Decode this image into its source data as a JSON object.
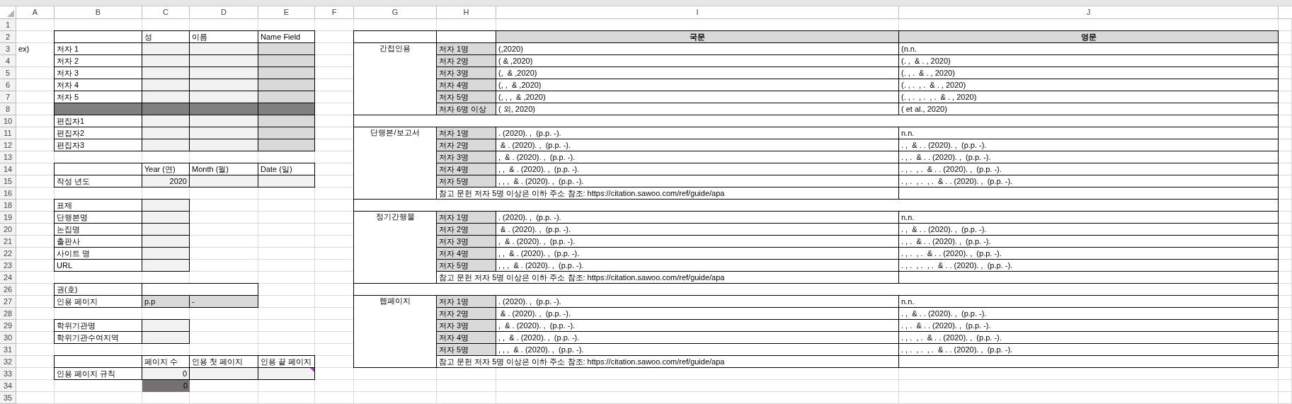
{
  "column_headers": [
    "A",
    "B",
    "C",
    "D",
    "E",
    "F",
    "G",
    "H",
    "I",
    "J"
  ],
  "rows": [
    {
      "number": "1"
    },
    {
      "number": "2",
      "cells": [
        {
          "kind": "blank"
        },
        {
          "kind": "label"
        },
        {
          "kind": "label",
          "text": "성"
        },
        {
          "kind": "label",
          "text": "이름"
        },
        {
          "kind": "label",
          "text": "Name Field"
        },
        {
          "kind": "blank"
        },
        {
          "kind": "label"
        },
        {
          "kind": "label"
        },
        {
          "kind": "head",
          "text": "국문"
        },
        {
          "kind": "head",
          "text": "영문"
        }
      ]
    },
    {
      "number": "3",
      "cells": [
        {
          "kind": "plain",
          "text": "ex)"
        },
        {
          "kind": "label",
          "text": "저자 1"
        },
        {
          "kind": "input"
        },
        {
          "kind": "input"
        },
        {
          "kind": "field"
        },
        {
          "kind": "blank"
        },
        {
          "kind": "group",
          "text": "간접인용"
        },
        {
          "kind": "key",
          "text": "저자 1명"
        },
        {
          "kind": "label",
          "text": "(,2020)"
        },
        {
          "kind": "label",
          "text": "(n.n."
        }
      ]
    },
    {
      "number": "4",
      "cells": [
        {
          "kind": "blank"
        },
        {
          "kind": "label",
          "text": "저자 2"
        },
        {
          "kind": "input"
        },
        {
          "kind": "input"
        },
        {
          "kind": "field"
        },
        {
          "kind": "blank"
        },
        {
          "kind": "up"
        },
        {
          "kind": "key",
          "text": "저자 2명"
        },
        {
          "kind": "label",
          "text": "( & ,2020)"
        },
        {
          "kind": "label",
          "text": "(. ,  & . , 2020)"
        }
      ]
    },
    {
      "number": "5",
      "cells": [
        {
          "kind": "blank"
        },
        {
          "kind": "label",
          "text": "저자 3"
        },
        {
          "kind": "input"
        },
        {
          "kind": "input"
        },
        {
          "kind": "field"
        },
        {
          "kind": "blank"
        },
        {
          "kind": "up"
        },
        {
          "kind": "key",
          "text": "저자 3명"
        },
        {
          "kind": "label",
          "text": "(,  & ,2020)"
        },
        {
          "kind": "label",
          "text": "(. , .  & . , 2020)"
        }
      ]
    },
    {
      "number": "6",
      "cells": [
        {
          "kind": "blank"
        },
        {
          "kind": "label",
          "text": "저자 4"
        },
        {
          "kind": "input"
        },
        {
          "kind": "input"
        },
        {
          "kind": "field"
        },
        {
          "kind": "blank"
        },
        {
          "kind": "up"
        },
        {
          "kind": "key",
          "text": "저자 4명"
        },
        {
          "kind": "label",
          "text": "(, ,  & ,2020)"
        },
        {
          "kind": "label",
          "text": "(. , .  , .  & . , 2020)"
        }
      ]
    },
    {
      "number": "7",
      "cells": [
        {
          "kind": "blank"
        },
        {
          "kind": "label",
          "text": "저자 5"
        },
        {
          "kind": "input"
        },
        {
          "kind": "input"
        },
        {
          "kind": "field"
        },
        {
          "kind": "blank"
        },
        {
          "kind": "up"
        },
        {
          "kind": "key",
          "text": "저자 5명"
        },
        {
          "kind": "label",
          "text": "(, , ,  & ,2020)"
        },
        {
          "kind": "label",
          "text": "(. , .  , .  , .  & . , 2020)"
        }
      ]
    },
    {
      "number": "8",
      "cells": [
        {
          "kind": "blank"
        },
        {
          "kind": "dark"
        },
        {
          "kind": "dark"
        },
        {
          "kind": "dark"
        },
        {
          "kind": "dark"
        },
        {
          "kind": "blank"
        },
        {
          "kind": "up"
        },
        {
          "kind": "key",
          "text": "저자 6명 이상"
        },
        {
          "kind": "label",
          "text": "( 외, 2020)"
        },
        {
          "kind": "label",
          "text": "( et al., 2020)"
        }
      ]
    },
    {
      "number": "10",
      "cells": [
        {
          "kind": "blank"
        },
        {
          "kind": "label",
          "text": "편집자1"
        },
        {
          "kind": "input"
        },
        {
          "kind": "input"
        },
        {
          "kind": "field"
        },
        {
          "kind": "blank"
        },
        {
          "kind": "label"
        },
        {
          "kind": "left"
        },
        {
          "kind": "left"
        },
        {
          "kind": "left"
        }
      ]
    },
    {
      "number": "11",
      "cells": [
        {
          "kind": "blank"
        },
        {
          "kind": "label",
          "text": "편집자2"
        },
        {
          "kind": "input"
        },
        {
          "kind": "input"
        },
        {
          "kind": "field"
        },
        {
          "kind": "blank"
        },
        {
          "kind": "group",
          "text": "단행본/보고서"
        },
        {
          "kind": "key",
          "text": "저자 1명"
        },
        {
          "kind": "label",
          "text": ". (2020). ,  (p.p. -)."
        },
        {
          "kind": "label",
          "text": "n.n."
        }
      ]
    },
    {
      "number": "12",
      "cells": [
        {
          "kind": "blank"
        },
        {
          "kind": "label",
          "text": "편집자3"
        },
        {
          "kind": "input"
        },
        {
          "kind": "input"
        },
        {
          "kind": "field"
        },
        {
          "kind": "blank"
        },
        {
          "kind": "up"
        },
        {
          "kind": "key",
          "text": "저자 2명"
        },
        {
          "kind": "label",
          "text": " & . (2020). ,  (p.p. -)."
        },
        {
          "kind": "label",
          "text": ". ,  & . . (2020). ,  (p.p. -)."
        }
      ]
    },
    {
      "number": "13",
      "cells": [
        {
          "kind": "blank"
        },
        {
          "kind": "blank"
        },
        {
          "kind": "blank"
        },
        {
          "kind": "blank"
        },
        {
          "kind": "blank"
        },
        {
          "kind": "blank"
        },
        {
          "kind": "up"
        },
        {
          "kind": "key",
          "text": "저자 3명"
        },
        {
          "kind": "label",
          "text": ",  & . (2020). ,  (p.p. -)."
        },
        {
          "kind": "label",
          "text": ". , .  & . . (2020). ,  (p.p. -)."
        }
      ]
    },
    {
      "number": "14",
      "cells": [
        {
          "kind": "blank"
        },
        {
          "kind": "label"
        },
        {
          "kind": "label",
          "text": "Year (연)"
        },
        {
          "kind": "label",
          "text": "Month (월)"
        },
        {
          "kind": "label",
          "text": "Date (일)"
        },
        {
          "kind": "blank"
        },
        {
          "kind": "up"
        },
        {
          "kind": "key",
          "text": "저자 4명"
        },
        {
          "kind": "label",
          "text": ", ,  & . (2020). ,  (p.p. -)."
        },
        {
          "kind": "label",
          "text": ". , .  , .  & . . (2020). ,  (p.p. -)."
        }
      ]
    },
    {
      "number": "15",
      "cells": [
        {
          "kind": "blank"
        },
        {
          "kind": "label",
          "text": "작성 년도"
        },
        {
          "kind": "input-number",
          "text": "2020"
        },
        {
          "kind": "input"
        },
        {
          "kind": "input"
        },
        {
          "kind": "blank"
        },
        {
          "kind": "up"
        },
        {
          "kind": "key",
          "text": "저자 5명"
        },
        {
          "kind": "label",
          "text": ", , ,  & . (2020). ,  (p.p. -)."
        },
        {
          "kind": "label",
          "text": ". , .  , .  , .  & . . (2020). ,  (p.p. -)."
        }
      ]
    },
    {
      "number": "16",
      "cells": [
        {
          "kind": "blank"
        },
        {
          "kind": "blank"
        },
        {
          "kind": "blank"
        },
        {
          "kind": "blank"
        },
        {
          "kind": "blank"
        },
        {
          "kind": "blank"
        },
        {
          "kind": "up"
        },
        {
          "kind": "label",
          "text": "참고 문헌 저자 5명 이상은 이하 주소 참조: https://citation.sawoo.com/ref/guide/apa"
        },
        {
          "kind": "left"
        },
        {
          "kind": "label"
        }
      ]
    },
    {
      "number": "18",
      "cells": [
        {
          "kind": "blank"
        },
        {
          "kind": "label",
          "text": "표제"
        },
        {
          "kind": "input"
        },
        {
          "kind": "blank"
        },
        {
          "kind": "blank"
        },
        {
          "kind": "blank"
        },
        {
          "kind": "label"
        },
        {
          "kind": "left"
        },
        {
          "kind": "left"
        },
        {
          "kind": "left"
        }
      ]
    },
    {
      "number": "19",
      "cells": [
        {
          "kind": "blank"
        },
        {
          "kind": "label",
          "text": "단행본명"
        },
        {
          "kind": "input"
        },
        {
          "kind": "blank"
        },
        {
          "kind": "blank"
        },
        {
          "kind": "blank"
        },
        {
          "kind": "group",
          "text": "정기간행물"
        },
        {
          "kind": "key",
          "text": "저자 1명"
        },
        {
          "kind": "label",
          "text": ". (2020). ,  (p.p. -)."
        },
        {
          "kind": "label",
          "text": "n.n."
        }
      ]
    },
    {
      "number": "20",
      "cells": [
        {
          "kind": "blank"
        },
        {
          "kind": "label",
          "text": "논집명"
        },
        {
          "kind": "input"
        },
        {
          "kind": "blank"
        },
        {
          "kind": "blank"
        },
        {
          "kind": "blank"
        },
        {
          "kind": "up"
        },
        {
          "kind": "key",
          "text": "저자 2명"
        },
        {
          "kind": "label",
          "text": " & . (2020). ,  (p.p. -)."
        },
        {
          "kind": "label",
          "text": ". ,  & . . (2020). ,  (p.p. -)."
        }
      ]
    },
    {
      "number": "21",
      "cells": [
        {
          "kind": "blank"
        },
        {
          "kind": "label",
          "text": "출판사"
        },
        {
          "kind": "input"
        },
        {
          "kind": "blank"
        },
        {
          "kind": "blank"
        },
        {
          "kind": "blank"
        },
        {
          "kind": "up"
        },
        {
          "kind": "key",
          "text": "저자 3명"
        },
        {
          "kind": "label",
          "text": ",  & . (2020). ,  (p.p. -)."
        },
        {
          "kind": "label",
          "text": ". , .  & . . (2020). ,  (p.p. -)."
        }
      ]
    },
    {
      "number": "22",
      "cells": [
        {
          "kind": "blank"
        },
        {
          "kind": "label",
          "text": "사이트 명"
        },
        {
          "kind": "input"
        },
        {
          "kind": "blank"
        },
        {
          "kind": "blank"
        },
        {
          "kind": "blank"
        },
        {
          "kind": "up"
        },
        {
          "kind": "key",
          "text": "저자 4명"
        },
        {
          "kind": "label",
          "text": ", ,  & . (2020). ,  (p.p. -)."
        },
        {
          "kind": "label",
          "text": ". , .  , .  & . . (2020). ,  (p.p. -)."
        }
      ]
    },
    {
      "number": "23",
      "cells": [
        {
          "kind": "blank"
        },
        {
          "kind": "label",
          "text": "URL"
        },
        {
          "kind": "input"
        },
        {
          "kind": "blank"
        },
        {
          "kind": "blank"
        },
        {
          "kind": "blank"
        },
        {
          "kind": "up"
        },
        {
          "kind": "key",
          "text": "저자 5명"
        },
        {
          "kind": "label",
          "text": ", , ,  & . (2020). ,  (p.p. -)."
        },
        {
          "kind": "label",
          "text": ". , .  , .  , .  & . . (2020). ,  (p.p. -)."
        }
      ]
    },
    {
      "number": "24",
      "cells": [
        {
          "kind": "blank"
        },
        {
          "kind": "blank"
        },
        {
          "kind": "blank"
        },
        {
          "kind": "blank"
        },
        {
          "kind": "blank"
        },
        {
          "kind": "blank"
        },
        {
          "kind": "up"
        },
        {
          "kind": "label",
          "text": "참고 문헌 저자 5명 이상은 이하 주소 참조: https://citation.sawoo.com/ref/guide/apa"
        },
        {
          "kind": "left"
        },
        {
          "kind": "label"
        }
      ]
    },
    {
      "number": "26",
      "cells": [
        {
          "kind": "blank"
        },
        {
          "kind": "label",
          "text": "권(호)"
        },
        {
          "kind": "label"
        },
        {
          "kind": "left"
        },
        {
          "kind": "blank"
        },
        {
          "kind": "blank"
        },
        {
          "kind": "label"
        },
        {
          "kind": "left"
        },
        {
          "kind": "left"
        },
        {
          "kind": "left"
        }
      ]
    },
    {
      "number": "27",
      "cells": [
        {
          "kind": "blank"
        },
        {
          "kind": "label",
          "text": "인용 페이지"
        },
        {
          "kind": "field",
          "text": "p.p"
        },
        {
          "kind": "field",
          "text": "-"
        },
        {
          "kind": "blank"
        },
        {
          "kind": "blank"
        },
        {
          "kind": "group",
          "text": "웹페이지"
        },
        {
          "kind": "key",
          "text": "저자 1명"
        },
        {
          "kind": "label",
          "text": ". (2020). ,  (p.p. -)."
        },
        {
          "kind": "label",
          "text": "n.n."
        }
      ]
    },
    {
      "number": "28",
      "cells": [
        {
          "kind": "blank"
        },
        {
          "kind": "blank"
        },
        {
          "kind": "blank"
        },
        {
          "kind": "blank"
        },
        {
          "kind": "blank"
        },
        {
          "kind": "blank"
        },
        {
          "kind": "up"
        },
        {
          "kind": "key",
          "text": "저자 2명"
        },
        {
          "kind": "label",
          "text": " & . (2020). ,  (p.p. -)."
        },
        {
          "kind": "label",
          "text": ". ,  & . . (2020). ,  (p.p. -)."
        }
      ]
    },
    {
      "number": "29",
      "cells": [
        {
          "kind": "blank"
        },
        {
          "kind": "label",
          "text": "학위기관명"
        },
        {
          "kind": "input"
        },
        {
          "kind": "blank"
        },
        {
          "kind": "blank"
        },
        {
          "kind": "blank"
        },
        {
          "kind": "up"
        },
        {
          "kind": "key",
          "text": "저자 3명"
        },
        {
          "kind": "label",
          "text": ",  & . (2020). ,  (p.p. -)."
        },
        {
          "kind": "label",
          "text": ". , .  & . . (2020). ,  (p.p. -)."
        }
      ]
    },
    {
      "number": "30",
      "cells": [
        {
          "kind": "blank"
        },
        {
          "kind": "label",
          "text": "학위기관수여지역"
        },
        {
          "kind": "input"
        },
        {
          "kind": "blank"
        },
        {
          "kind": "blank"
        },
        {
          "kind": "blank"
        },
        {
          "kind": "up"
        },
        {
          "kind": "key",
          "text": "저자 4명"
        },
        {
          "kind": "label",
          "text": ", ,  & . (2020). ,  (p.p. -)."
        },
        {
          "kind": "label",
          "text": ". , .  , .  & . . (2020). ,  (p.p. -)."
        }
      ]
    },
    {
      "number": "31",
      "cells": [
        {
          "kind": "blank"
        },
        {
          "kind": "blank"
        },
        {
          "kind": "blank"
        },
        {
          "kind": "blank"
        },
        {
          "kind": "blank"
        },
        {
          "kind": "blank"
        },
        {
          "kind": "up"
        },
        {
          "kind": "key",
          "text": "저자 5명"
        },
        {
          "kind": "label",
          "text": ", , ,  & . (2020). ,  (p.p. -)."
        },
        {
          "kind": "label",
          "text": ". , .  , .  , .  & . . (2020). ,  (p.p. -)."
        }
      ]
    },
    {
      "number": "32",
      "cells": [
        {
          "kind": "blank"
        },
        {
          "kind": "label"
        },
        {
          "kind": "label",
          "text": "페이지 수"
        },
        {
          "kind": "label",
          "text": "인용 첫 페이지"
        },
        {
          "kind": "label",
          "text": "인용 끝 페이지"
        },
        {
          "kind": "blank"
        },
        {
          "kind": "up"
        },
        {
          "kind": "label",
          "text": "참고 문헌 저자 5명 이상은 이하 주소 참조: https://citation.sawoo.com/ref/guide/apa"
        },
        {
          "kind": "left"
        },
        {
          "kind": "label"
        }
      ]
    },
    {
      "number": "33",
      "cells": [
        {
          "kind": "blank"
        },
        {
          "kind": "label",
          "text": "인용 페이지 규칙"
        },
        {
          "kind": "input-number",
          "text": "0"
        },
        {
          "kind": "input"
        },
        {
          "kind": "input",
          "comment": true
        }
      ]
    },
    {
      "number": "34",
      "cells": [
        {
          "kind": "blank"
        },
        {
          "kind": "blank"
        },
        {
          "kind": "dark-number",
          "text": "0"
        }
      ]
    },
    {
      "number": "35"
    }
  ]
}
